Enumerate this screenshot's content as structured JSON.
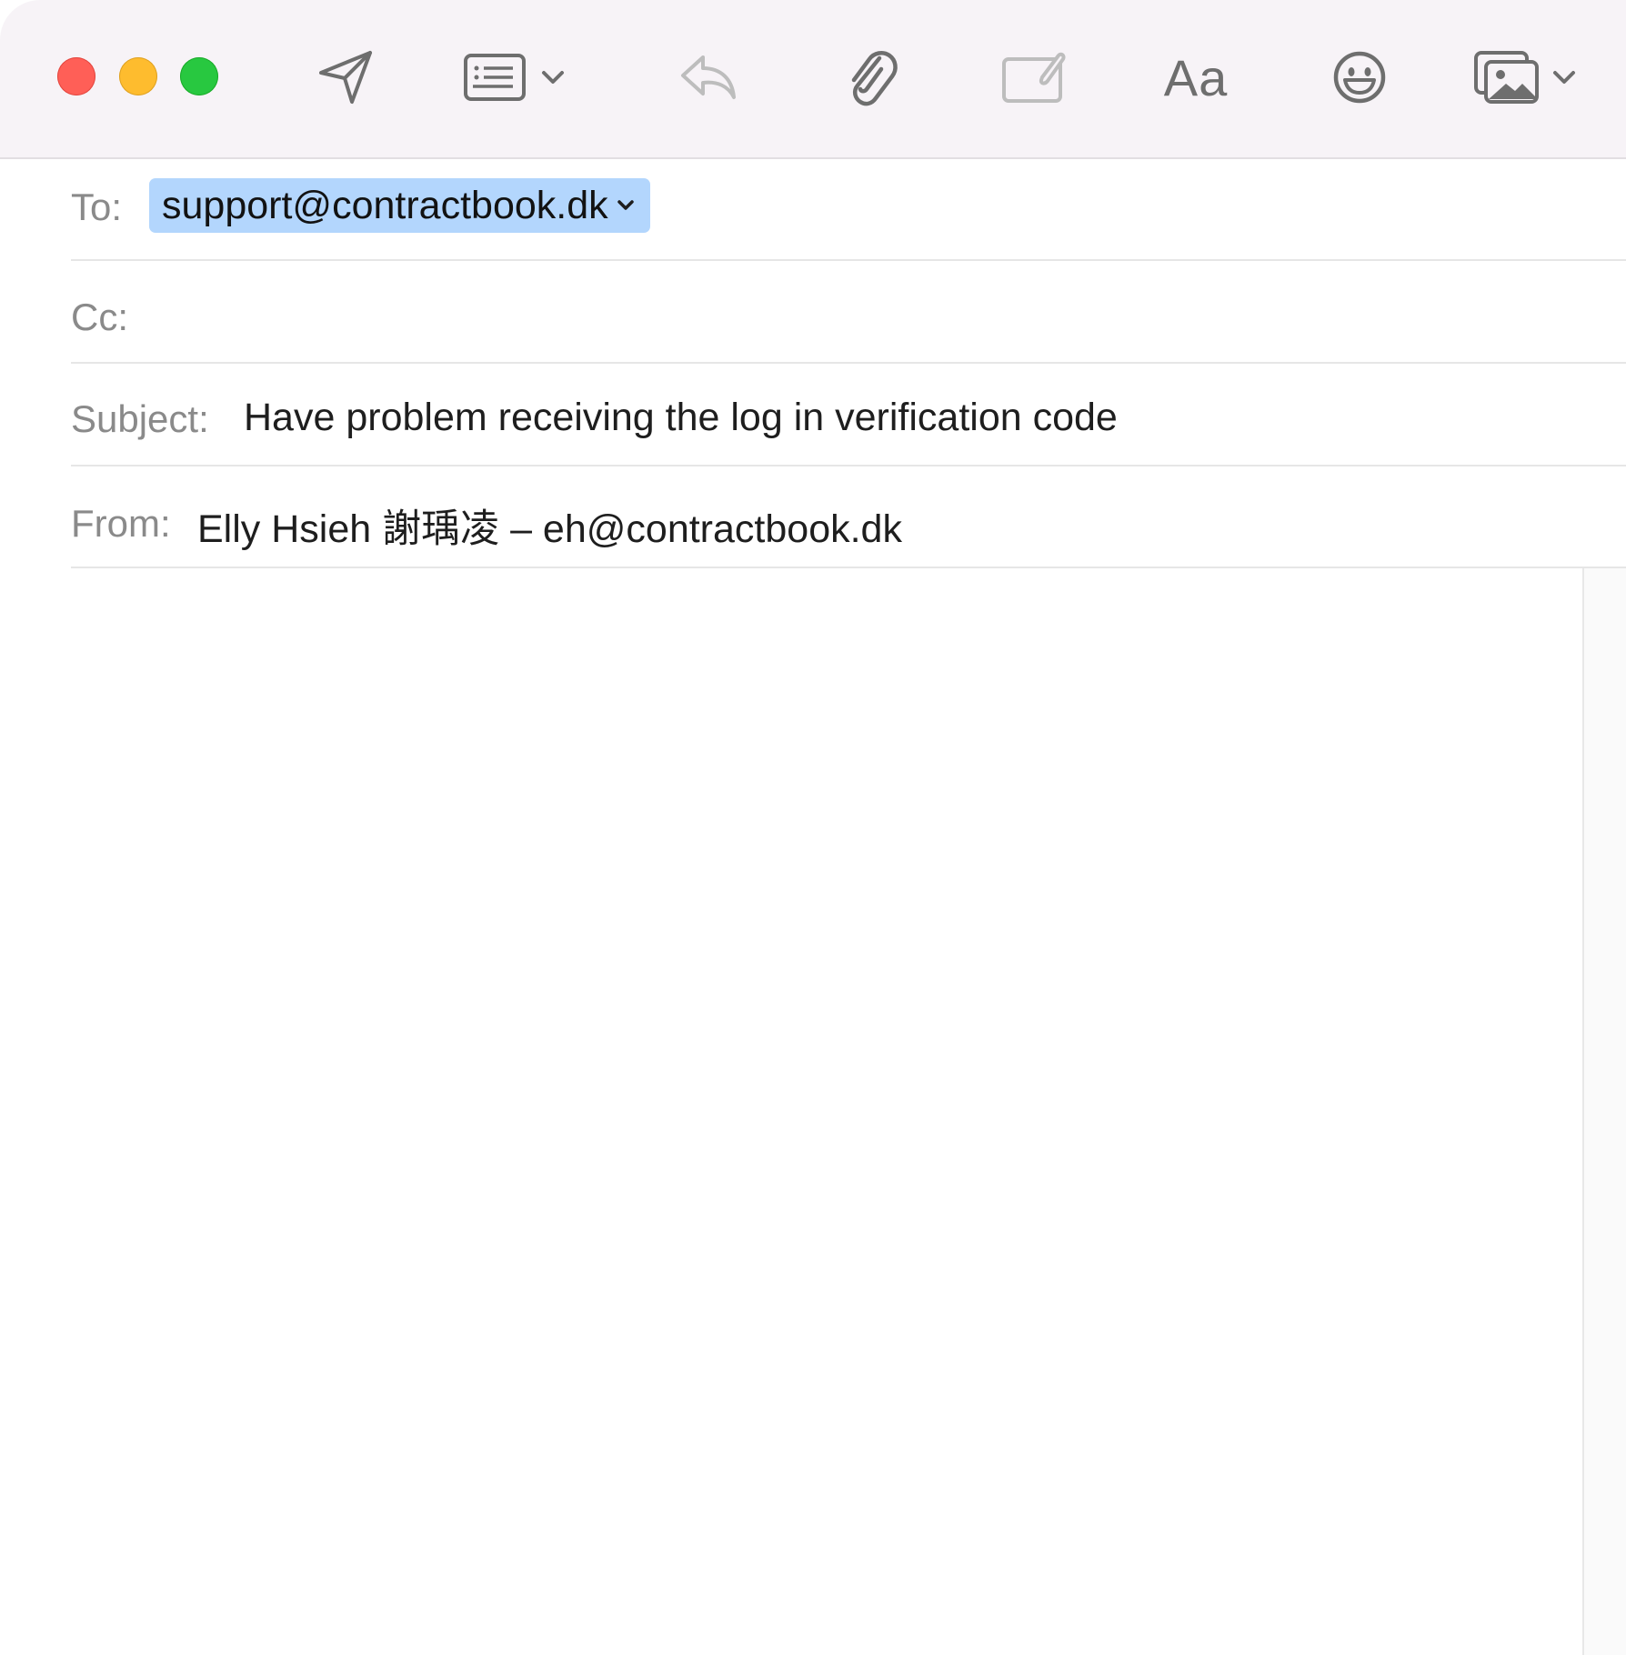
{
  "window": {
    "controls": {
      "close": {
        "color": "#ff5f57"
      },
      "minimize": {
        "color": "#febc2e"
      },
      "zoom": {
        "color": "#28c840"
      }
    }
  },
  "toolbar": {
    "buttons": [
      {
        "id": "send",
        "icon": "paper-plane-icon",
        "enabled": true
      },
      {
        "id": "header-fields",
        "icon": "header-list-icon",
        "has_dropdown": true,
        "enabled": true
      },
      {
        "id": "reply",
        "icon": "reply-arrow-icon",
        "enabled": false
      },
      {
        "id": "attach",
        "icon": "paperclip-icon",
        "enabled": true
      },
      {
        "id": "markup",
        "icon": "markup-icon",
        "enabled": false
      },
      {
        "id": "format",
        "icon": "format-text-icon",
        "label": "Aa",
        "enabled": true
      },
      {
        "id": "emoji",
        "icon": "smiley-icon",
        "enabled": true
      },
      {
        "id": "photo-browser",
        "icon": "photo-browser-icon",
        "has_dropdown": true,
        "enabled": true
      }
    ]
  },
  "fields": {
    "to": {
      "label": "To:",
      "recipients": [
        "support@contractbook.dk"
      ]
    },
    "cc": {
      "label": "Cc:",
      "value": ""
    },
    "subject": {
      "label": "Subject:",
      "value": "Have problem receiving the log in verification code"
    },
    "from": {
      "label": "From:",
      "value": "Elly Hsieh 謝瑀凌 – eh@contractbook.dk"
    }
  },
  "body": {
    "text": ""
  },
  "colors": {
    "toolbar_bg": "#f7f3f7",
    "token_bg": "#b3d6fd",
    "label_gray": "#8a8a8a",
    "icon_gray": "#6e6e6e",
    "icon_disabled": "#bdbdbd"
  }
}
